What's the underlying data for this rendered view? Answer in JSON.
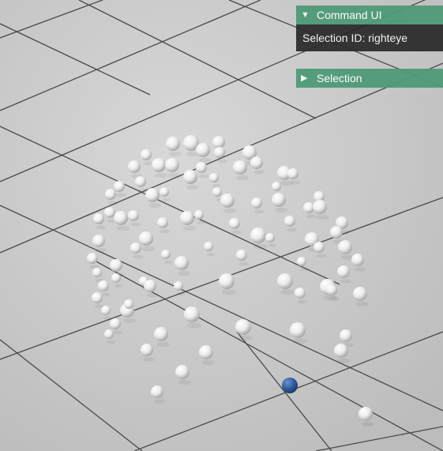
{
  "command_panel": {
    "title": "Command UI",
    "expanded_icon": "triangle-down-icon",
    "selection_label": "Selection ID:",
    "selection_value": "righteye"
  },
  "selection_panel": {
    "title": "Selection",
    "collapsed_icon": "triangle-right-icon"
  },
  "scene": {
    "floor_color": "#cfcfcf",
    "grid_color": "#4a4a4a",
    "marker_color": "#e9e9e9",
    "selected_marker_color": "#2f5d9c"
  }
}
